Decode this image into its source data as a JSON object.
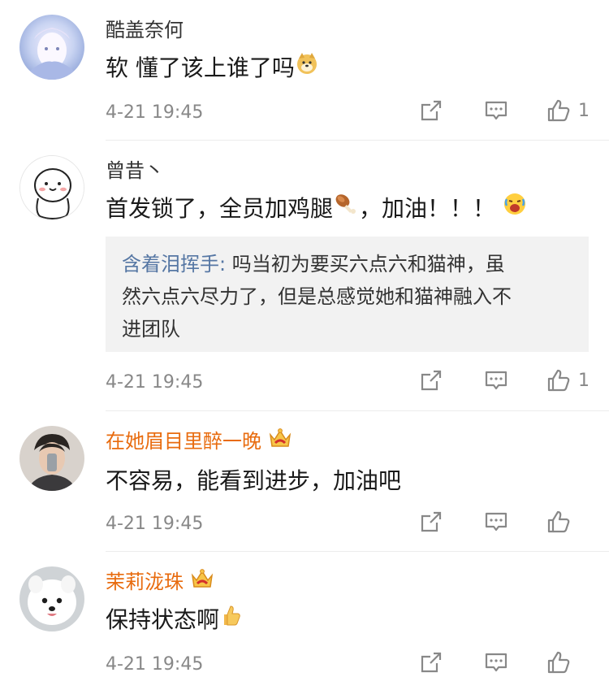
{
  "comments": [
    {
      "user": "酷盖奈何",
      "text": "软 懂了该上谁了吗",
      "emoji": "doge-emoji",
      "time": "4-21 19:45",
      "likes": "1"
    },
    {
      "user": "曾昔丶",
      "text_before": "首发锁了，全员加鸡腿",
      "text_after": "，加油！！！",
      "emoji_mid": "drumstick-emoji",
      "emoji_end": "excited-emoji",
      "reply_user": "含着泪挥手:",
      "reply_text_1": " 吗当初为要买六点六和猫神，虽",
      "reply_text_2": "然六点六尽力了，但是总感觉她和猫神融入不",
      "reply_text_3": "进团队",
      "time": "4-21 19:45",
      "likes": "1"
    },
    {
      "user": "在她眉目里醉一晚",
      "text": "不容易，能看到进步，加油吧",
      "time": "4-21 19:45",
      "likes": ""
    },
    {
      "user": "茉莉泷珠",
      "text": "保持状态啊",
      "emoji": "thumbs-up-emoji",
      "time": "4-21 19:45",
      "likes": ""
    }
  ],
  "colors": {
    "vip_name": "#e86b0e",
    "reply_user": "#5677a4",
    "meta": "#888888"
  }
}
